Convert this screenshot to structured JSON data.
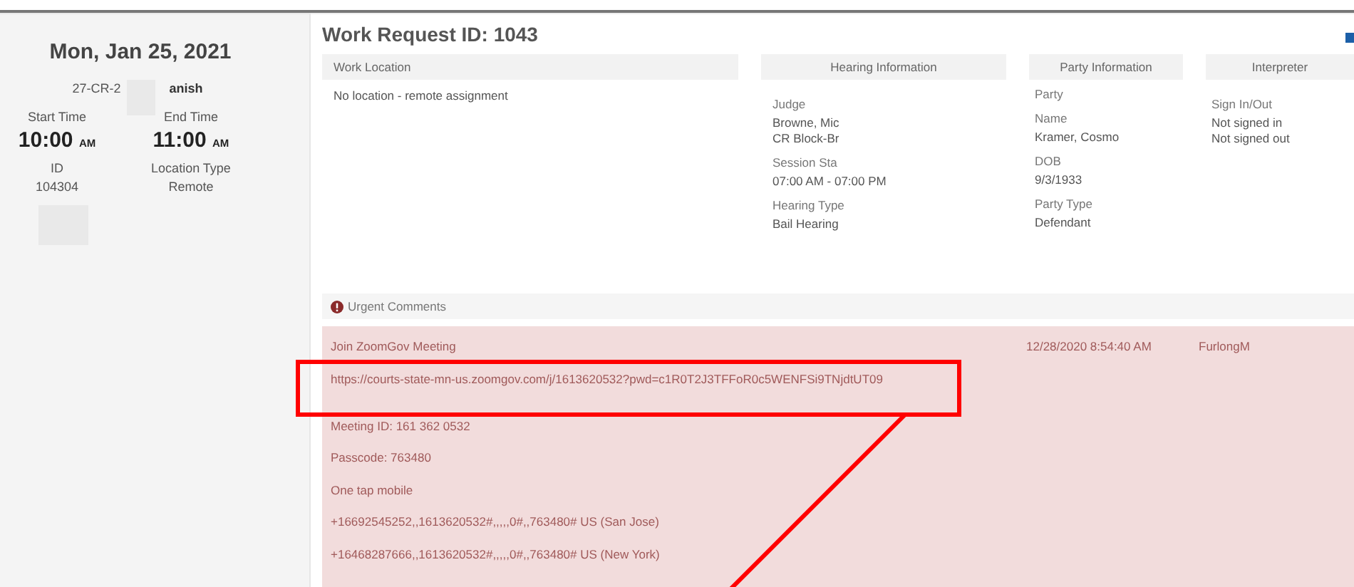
{
  "sidebar": {
    "date": "Mon, Jan 25, 2021",
    "case_number": "27-CR-2",
    "case_name": "anish",
    "times": [
      {
        "label": "Start Time",
        "time": "10:00",
        "period": "AM"
      },
      {
        "label": "End Time",
        "time": "11:00",
        "period": "AM"
      }
    ],
    "details": [
      {
        "label": "ID",
        "value": "104304"
      },
      {
        "label": "Location Type",
        "value": "Remote"
      }
    ]
  },
  "work_request": {
    "title": "Work Request ID: 1043",
    "sections": [
      {
        "heading": "Work Location",
        "fields": [
          {
            "values": [
              "No location - remote assignment"
            ]
          }
        ]
      },
      {
        "heading": "Hearing Information",
        "fields": [
          {
            "label": "Judge",
            "values": [
              "Browne, Mic",
              "CR Block-Br"
            ]
          },
          {
            "label": "Session Sta",
            "values": [
              "07:00 AM - 07:00 PM"
            ]
          },
          {
            "label": "Hearing Type",
            "values": [
              "Bail Hearing"
            ]
          }
        ]
      },
      {
        "heading": "Party Information",
        "fields": [
          {
            "label": "Party"
          },
          {
            "label": "Name",
            "values": [
              "Kramer, Cosmo"
            ]
          },
          {
            "label": "DOB",
            "values": [
              "9/3/1933"
            ]
          },
          {
            "label": "Party Type",
            "values": [
              "Defendant"
            ]
          }
        ]
      },
      {
        "heading": "Interpreter",
        "fields": [
          {
            "label": "Sign In/Out",
            "values": [
              "Not signed in",
              "Not signed out"
            ]
          }
        ]
      }
    ]
  },
  "urgent_comments": {
    "heading": "Urgent Comments",
    "items": [
      {
        "paragraphs": [
          [
            "Join ZoomGov Meeting",
            "https://courts-state-mn-us.zoomgov.com/j/1613620532?pwd=c1R0T2J3TFFoR0c5WENFSi9TNjdtUT09"
          ],
          [
            "Meeting ID: 161 362 0532",
            "Passcode: 763480",
            "One tap mobile",
            "+16692545252,,1613620532#,,,,,0#,,763480# US (San Jose)",
            "+16468287666,,1613620532#,,,,,0#,,763480# US (New York)"
          ]
        ],
        "date": "12/28/2020 8:54:40 AM",
        "author": "FurlongM"
      }
    ]
  }
}
